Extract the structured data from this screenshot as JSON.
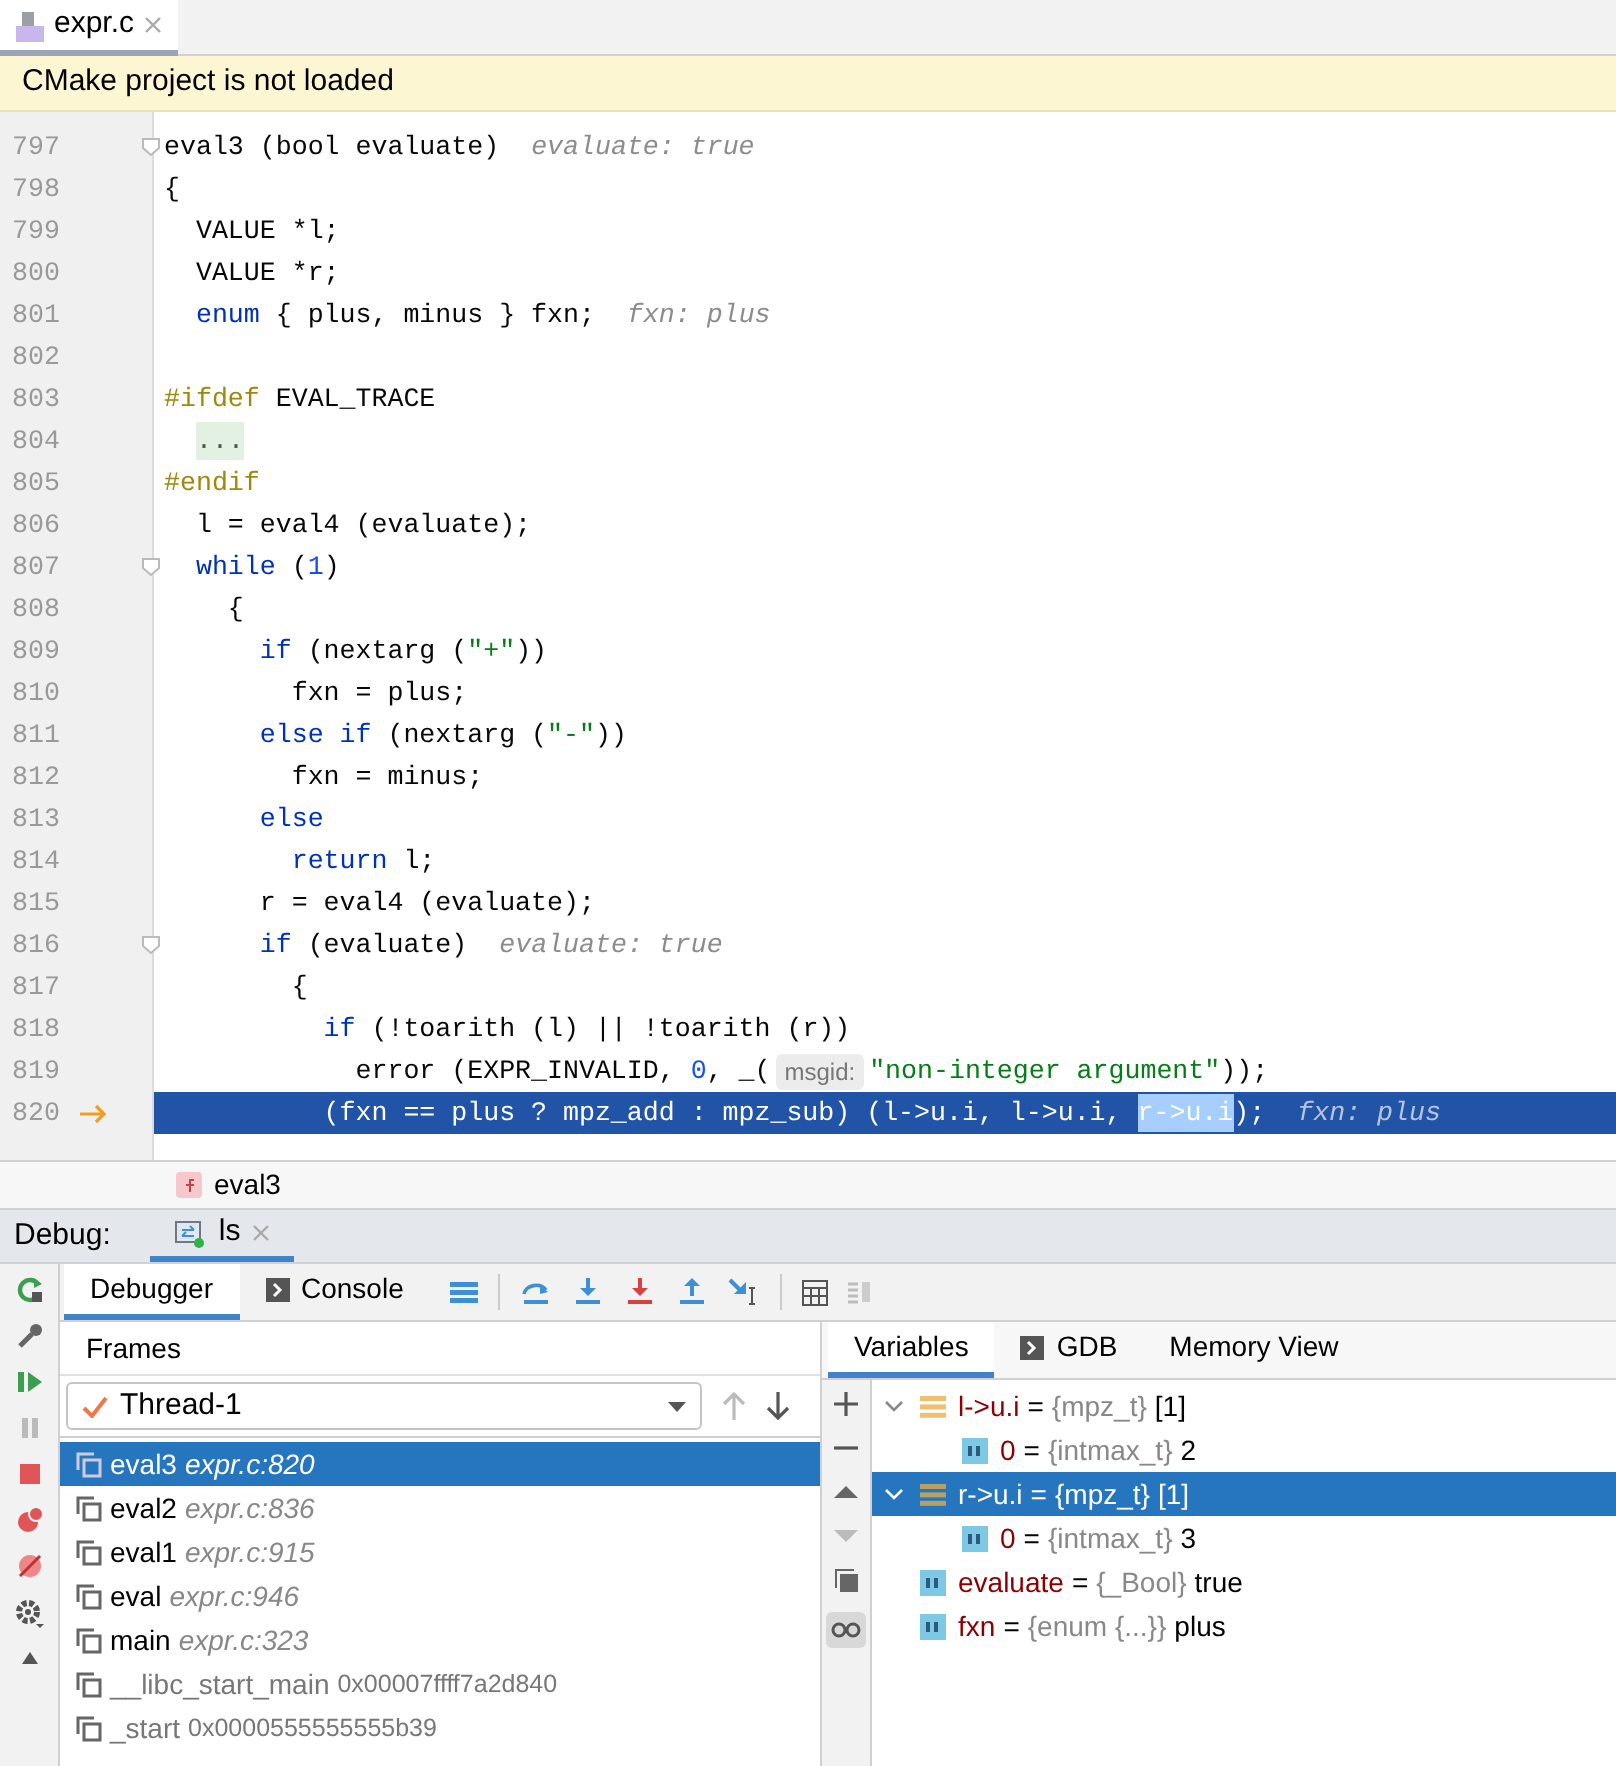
{
  "editor_tab": {
    "label": "expr.c",
    "selected": true
  },
  "banner": "CMake project is not loaded",
  "code_lines": [
    {
      "number": "797",
      "fold": true,
      "current": false,
      "tokens": [
        {
          "kind": "plain",
          "text": "eval3 (bool evaluate)"
        },
        {
          "kind": "hint",
          "text": "evaluate: true"
        }
      ]
    },
    {
      "number": "798",
      "fold": false,
      "current": false,
      "tokens": [
        {
          "kind": "plain",
          "text": "{"
        }
      ]
    },
    {
      "number": "799",
      "fold": false,
      "current": false,
      "tokens": [
        {
          "kind": "plain",
          "text": "  VALUE *l;"
        }
      ]
    },
    {
      "number": "800",
      "fold": false,
      "current": false,
      "tokens": [
        {
          "kind": "plain",
          "text": "  VALUE *r;"
        }
      ]
    },
    {
      "number": "801",
      "fold": false,
      "current": false,
      "tokens": [
        {
          "kind": "keyword",
          "text": "  enum"
        },
        {
          "kind": "plain",
          "text": " { plus, minus } fxn;"
        },
        {
          "kind": "hint",
          "text": "fxn: plus"
        }
      ]
    },
    {
      "number": "802",
      "fold": false,
      "current": false
    },
    {
      "number": "803",
      "fold": false,
      "current": false,
      "tokens": [
        {
          "kind": "preproc",
          "text": "#ifdef"
        },
        {
          "kind": "plain",
          "text": " EVAL_TRACE"
        }
      ]
    },
    {
      "number": "804",
      "fold": false,
      "current": false,
      "tokens": [
        {
          "kind": "folded",
          "text": "..."
        }
      ]
    },
    {
      "number": "805",
      "fold": false,
      "current": false,
      "tokens": [
        {
          "kind": "preproc",
          "text": "#endif"
        }
      ]
    },
    {
      "number": "806",
      "fold": false,
      "current": false,
      "tokens": [
        {
          "kind": "plain",
          "text": "  l = eval4 (evaluate);"
        }
      ]
    },
    {
      "number": "807",
      "fold": true,
      "current": false,
      "tokens": [
        {
          "kind": "keyword",
          "text": "  while"
        },
        {
          "kind": "plain",
          "text": " ("
        },
        {
          "kind": "number",
          "text": "1"
        },
        {
          "kind": "plain",
          "text": ")"
        }
      ]
    },
    {
      "number": "808",
      "fold": false,
      "current": false,
      "tokens": [
        {
          "kind": "plain",
          "text": "    {"
        }
      ]
    },
    {
      "number": "809",
      "fold": false,
      "current": false,
      "tokens": [
        {
          "kind": "keyword",
          "text": "      if"
        },
        {
          "kind": "plain",
          "text": " (nextarg ("
        },
        {
          "kind": "string",
          "text": "\"+\""
        },
        {
          "kind": "plain",
          "text": "))"
        }
      ]
    },
    {
      "number": "810",
      "fold": false,
      "current": false,
      "tokens": [
        {
          "kind": "plain",
          "text": "        fxn = plus;"
        }
      ]
    },
    {
      "number": "811",
      "fold": false,
      "current": false,
      "tokens": [
        {
          "kind": "keyword",
          "text": "      else if"
        },
        {
          "kind": "plain",
          "text": " (nextarg ("
        },
        {
          "kind": "string",
          "text": "\"-\""
        },
        {
          "kind": "plain",
          "text": "))"
        }
      ]
    },
    {
      "number": "812",
      "fold": false,
      "current": false,
      "tokens": [
        {
          "kind": "plain",
          "text": "        fxn = minus;"
        }
      ]
    },
    {
      "number": "813",
      "fold": false,
      "current": false,
      "tokens": [
        {
          "kind": "keyword",
          "text": "      else"
        }
      ]
    },
    {
      "number": "814",
      "fold": false,
      "current": false,
      "tokens": [
        {
          "kind": "keyword",
          "text": "        return"
        },
        {
          "kind": "plain",
          "text": " l;"
        }
      ]
    },
    {
      "number": "815",
      "fold": false,
      "current": false,
      "tokens": [
        {
          "kind": "plain",
          "text": "      r = eval4 (evaluate);"
        }
      ]
    },
    {
      "number": "816",
      "fold": true,
      "current": false,
      "tokens": [
        {
          "kind": "keyword",
          "text": "      if"
        },
        {
          "kind": "plain",
          "text": " (evaluate)"
        },
        {
          "kind": "hint",
          "text": "evaluate: true"
        }
      ]
    },
    {
      "number": "817",
      "fold": false,
      "current": false,
      "tokens": [
        {
          "kind": "plain",
          "text": "        {"
        }
      ]
    },
    {
      "number": "818",
      "fold": false,
      "current": false,
      "tokens": [
        {
          "kind": "keyword",
          "text": "          if"
        },
        {
          "kind": "plain",
          "text": " (!toarith (l) || !toarith (r))"
        }
      ]
    },
    {
      "number": "819",
      "fold": false,
      "current": false,
      "tokens": [
        {
          "kind": "plain",
          "text": "            error (EXPR_INVALID, "
        },
        {
          "kind": "number",
          "text": "0"
        },
        {
          "kind": "plain",
          "text": ", _("
        },
        {
          "kind": "param",
          "text": "msgid:"
        },
        {
          "kind": "string",
          "text": "\"non-integer argument\""
        },
        {
          "kind": "plain",
          "text": "));"
        }
      ]
    },
    {
      "number": "820",
      "fold": false,
      "current": true,
      "tokens": [
        {
          "kind": "plain",
          "text": "          (fxn == plus ? mpz_add : mpz_sub) (l->u.i, l->u.i, "
        },
        {
          "kind": "selection",
          "text": "r->u.i"
        },
        {
          "kind": "plain",
          "text": ");"
        },
        {
          "kind": "hint",
          "text": "fxn: plus"
        }
      ]
    }
  ],
  "breadcrumb": "eval3",
  "debug": {
    "label": "Debug:",
    "session_tab": {
      "label": "ls",
      "selected": true
    },
    "tabs": [
      {
        "label": "Debugger",
        "selected": true,
        "kind": "plain"
      },
      {
        "label": "Console",
        "selected": false,
        "kind": "console"
      }
    ],
    "frames_title": "Frames",
    "thread": "Thread-1",
    "frames": [
      {
        "name": "eval3",
        "location": "expr.c:820",
        "kind": "source",
        "selected": true
      },
      {
        "name": "eval2",
        "location": "expr.c:836",
        "kind": "source",
        "selected": false
      },
      {
        "name": "eval1",
        "location": "expr.c:915",
        "kind": "source",
        "selected": false
      },
      {
        "name": "eval",
        "location": "expr.c:946",
        "kind": "source",
        "selected": false
      },
      {
        "name": "main",
        "location": "expr.c:323",
        "kind": "source",
        "selected": false
      },
      {
        "name": "__libc_start_main",
        "location": "0x00007ffff7a2d840",
        "kind": "library",
        "selected": false
      },
      {
        "name": "_start",
        "location": "0x0000555555555b39",
        "kind": "library",
        "selected": false
      }
    ],
    "var_tabs": [
      {
        "label": "Variables",
        "selected": true,
        "kind": "plain"
      },
      {
        "label": "GDB",
        "selected": false,
        "kind": "console"
      },
      {
        "label": "Memory View",
        "selected": false,
        "kind": "plain"
      }
    ],
    "variables": [
      {
        "name": "l->u.i",
        "eq": "=",
        "type": "{mpz_t}",
        "value": "[1]",
        "kind": "array",
        "expanded": true,
        "selected": false,
        "children": [
          {
            "name": "0",
            "eq": "=",
            "type": "{intmax_t}",
            "value": "2",
            "kind": "primitive",
            "selected": false
          }
        ]
      },
      {
        "name": "r->u.i",
        "eq": "=",
        "type": "{mpz_t}",
        "value": "[1]",
        "kind": "array",
        "expanded": true,
        "selected": true,
        "children": [
          {
            "name": "0",
            "eq": "=",
            "type": "{intmax_t}",
            "value": "3",
            "kind": "primitive",
            "selected": false
          }
        ]
      },
      {
        "name": "evaluate",
        "eq": "=",
        "type": "{_Bool}",
        "value": "true",
        "kind": "primitive",
        "selected": false
      },
      {
        "name": "fxn",
        "eq": "=",
        "type": "{enum {...}}",
        "value": "plus",
        "kind": "primitive",
        "selected": false
      }
    ]
  }
}
